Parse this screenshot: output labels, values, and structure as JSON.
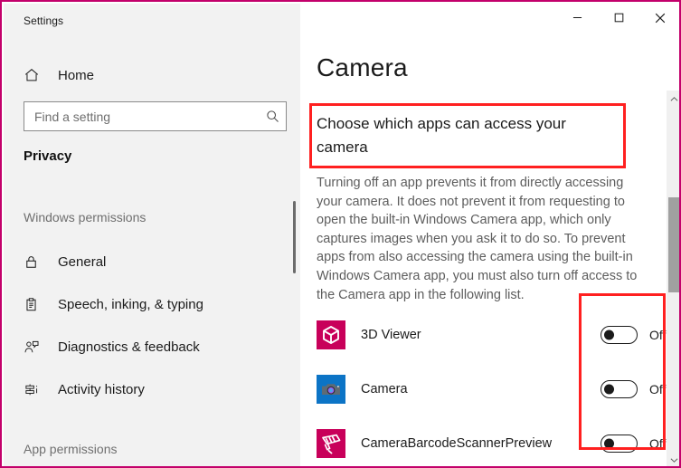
{
  "window": {
    "app_title": "Settings",
    "border_color": "#c3006b",
    "caption_buttons": [
      {
        "name": "minimize",
        "glyph": "minimize-icon"
      },
      {
        "name": "maximize",
        "glyph": "maximize-icon"
      },
      {
        "name": "close",
        "glyph": "close-icon"
      }
    ]
  },
  "sidebar": {
    "home": {
      "label": "Home",
      "icon": "home-icon"
    },
    "search": {
      "placeholder": "Find a setting",
      "value": "",
      "icon": "search-icon"
    },
    "category": "Privacy",
    "groups": [
      {
        "label": "Windows permissions"
      },
      {
        "label": "App permissions"
      }
    ],
    "items": [
      {
        "label": "General",
        "icon": "lock-icon"
      },
      {
        "label": "Speech, inking, & typing",
        "icon": "clipboard-icon"
      },
      {
        "label": "Diagnostics & feedback",
        "icon": "person-feedback-icon"
      },
      {
        "label": "Activity history",
        "icon": "timeline-icon"
      }
    ]
  },
  "main": {
    "page_title": "Camera",
    "section_heading": "Choose which apps can access your camera",
    "description": "Turning off an app prevents it from directly accessing your camera. It does not prevent it from requesting to open the built-in Windows Camera app, which only captures images when you ask it to do so. To prevent apps from also accessing the camera using the built-in Windows Camera app, you must also turn off access to the Camera app in the following list.",
    "apps": [
      {
        "name": "3D Viewer",
        "icon": "cube-3d-icon",
        "icon_bg": "#c8005a",
        "state": "Off",
        "enabled": false
      },
      {
        "name": "Camera",
        "icon": "camera-icon",
        "icon_bg": "#0c74c6",
        "state": "Off",
        "enabled": false
      },
      {
        "name": "CameraBarcodeScannerPreview",
        "icon": "barcode-scanner-icon",
        "icon_bg": "#c8005a",
        "state": "Off",
        "enabled": false
      }
    ],
    "scrollbar": {
      "up": "chevron-up-icon",
      "down": "chevron-down-icon"
    }
  },
  "annotations": {
    "color": "#ff2020",
    "boxes": [
      {
        "name": "heading-highlight"
      },
      {
        "name": "toggles-highlight"
      }
    ]
  }
}
